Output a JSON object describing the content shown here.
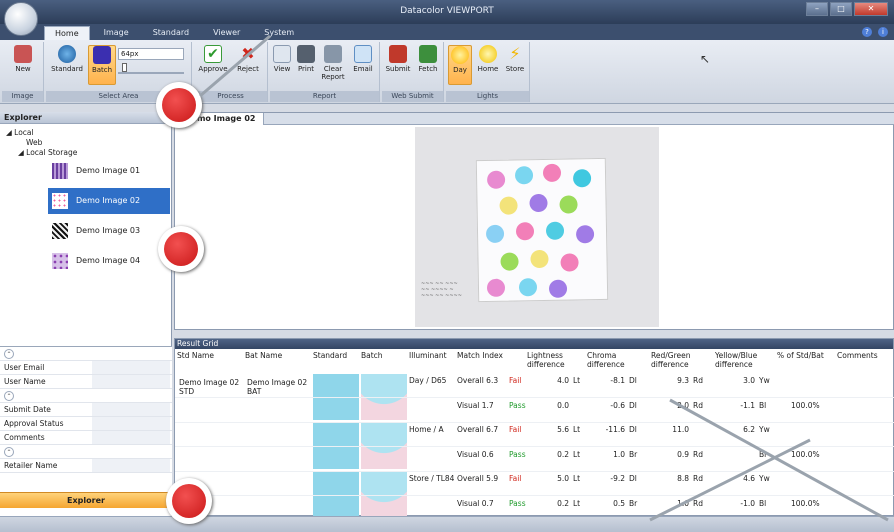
{
  "app": {
    "title": "Datacolor VIEWPORT"
  },
  "tabs": [
    "Home",
    "Image",
    "Standard",
    "Viewer",
    "System"
  ],
  "ribbon": {
    "groups": {
      "image": "Image",
      "select_area": "Select Area",
      "process": "Process",
      "report": "Report",
      "web_submit": "Web Submit",
      "lights": "Lights"
    },
    "buttons": {
      "new": "New",
      "standard": "Standard",
      "batch": "Batch",
      "approve": "Approve",
      "reject": "Reject",
      "view": "View",
      "print": "Print",
      "clear_report": "Clear Report",
      "email": "Email",
      "submit": "Submit",
      "fetch": "Fetch",
      "day": "Day",
      "home": "Home",
      "store": "Store"
    },
    "size_value": "64px"
  },
  "explorer": {
    "title": "Explorer",
    "local": "Local",
    "web": "Web",
    "local_storage": "Local Storage",
    "images": [
      "Demo Image 01",
      "Demo Image 02",
      "Demo Image 03",
      "Demo Image 04"
    ],
    "selected_index": 1,
    "footer": "Explorer"
  },
  "props": {
    "user_email": "User Email",
    "user_name": "User Name",
    "submit_date": "Submit Date",
    "approval_status": "Approval Status",
    "comments": "Comments",
    "retailer_name": "Retailer Name"
  },
  "image_panel": {
    "tab": "Demo Image 02"
  },
  "grid": {
    "title": "Result Grid",
    "columns": [
      "Std Name",
      "Bat Name",
      "Standard",
      "Batch",
      "Illuminant",
      "Match Index",
      "Lightness difference",
      "Chroma difference",
      "Red/Green difference",
      "Yellow/Blue difference",
      "% of Std/Bat",
      "Comments"
    ],
    "std_name": "Demo Image 02 STD",
    "bat_name": "Demo Image 02 BAT",
    "rows": [
      {
        "illuminant": "Day / D65",
        "match": "Overall 6.3",
        "status": "Fail",
        "light": "4.0",
        "light_u": "Lt",
        "chroma": "-8.1",
        "chroma_u": "Dl",
        "rg": "9.3",
        "rg_u": "Rd",
        "yb": "3.0",
        "yb_u": "Yw",
        "pct": ""
      },
      {
        "illuminant": "",
        "match": "Visual 1.7",
        "status": "Pass",
        "light": "0.0",
        "light_u": "",
        "chroma": "-0.6",
        "chroma_u": "Dl",
        "rg": "2.0",
        "rg_u": "Rd",
        "yb": "-1.1",
        "yb_u": "Bl",
        "pct": "100.0%"
      },
      {
        "illuminant": "Home / A",
        "match": "Overall 6.7",
        "status": "Fail",
        "light": "5.6",
        "light_u": "Lt",
        "chroma": "-11.6",
        "chroma_u": "Dl",
        "rg": "11.0",
        "rg_u": "",
        "yb": "6.2",
        "yb_u": "Yw",
        "pct": ""
      },
      {
        "illuminant": "",
        "match": "Visual 0.6",
        "status": "Pass",
        "light": "0.2",
        "light_u": "Lt",
        "chroma": "1.0",
        "chroma_u": "Br",
        "rg": "0.9",
        "rg_u": "Rd",
        "yb": "",
        "yb_u": "Bl",
        "pct": "100.0%"
      },
      {
        "illuminant": "Store / TL84",
        "match": "Overall 5.9",
        "status": "Fail",
        "light": "5.0",
        "light_u": "Lt",
        "chroma": "-9.2",
        "chroma_u": "Dl",
        "rg": "8.8",
        "rg_u": "Rd",
        "yb": "4.6",
        "yb_u": "Yw",
        "pct": ""
      },
      {
        "illuminant": "",
        "match": "Visual 0.7",
        "status": "Pass",
        "light": "0.2",
        "light_u": "Lt",
        "chroma": "0.5",
        "chroma_u": "Br",
        "rg": "1.0",
        "rg_u": "Rd",
        "yb": "-1.0",
        "yb_u": "Bl",
        "pct": "100.0%"
      }
    ]
  },
  "colors": {
    "fail": "#d0261b",
    "pass": "#1f9a2b",
    "selected": "#2f6fc7",
    "accent": "#f5a531",
    "marker": "#c91717"
  }
}
